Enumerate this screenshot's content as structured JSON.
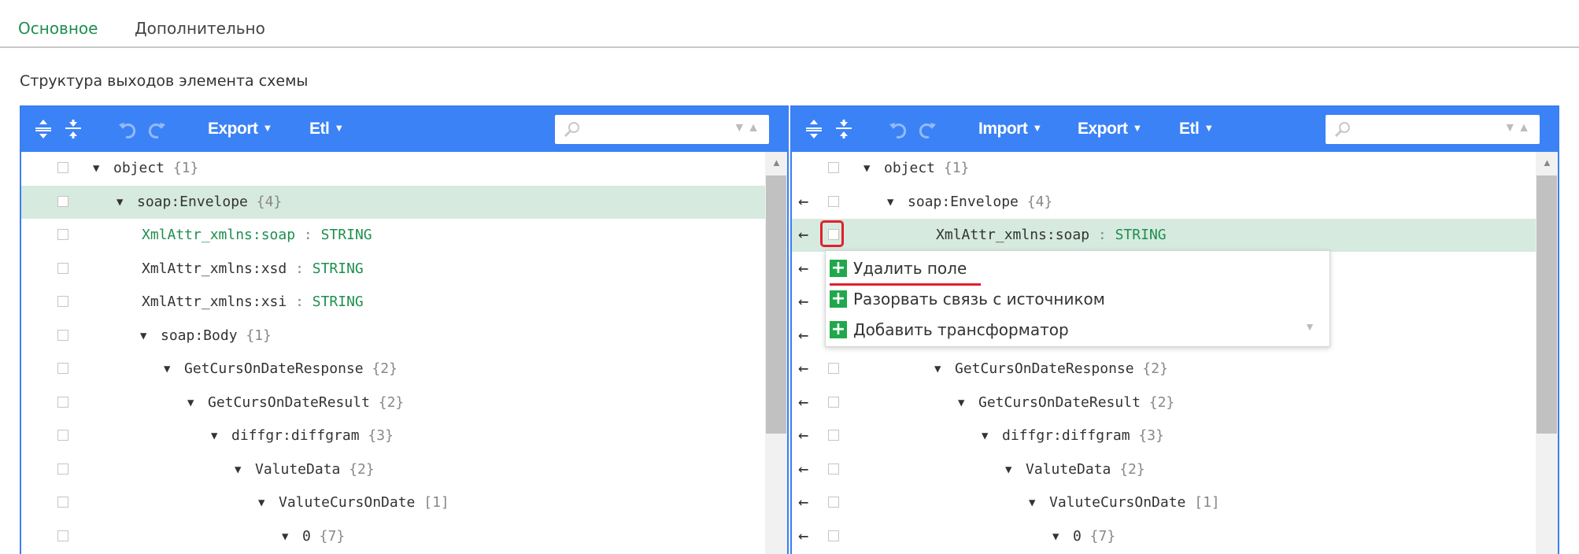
{
  "tabs": [
    {
      "label": "Основное",
      "active": true
    },
    {
      "label": "Дополнительно",
      "active": false
    }
  ],
  "section_title": "Структура выходов элемента схемы",
  "toolbar_left": {
    "icons": [
      "expand-all-icon",
      "collapse-all-icon",
      "undo-icon",
      "redo-icon"
    ],
    "export_label": "Export",
    "etl_label": "Etl",
    "search_placeholder": ""
  },
  "toolbar_right": {
    "icons": [
      "expand-all-icon",
      "collapse-all-icon",
      "undo-icon",
      "redo-icon"
    ],
    "import_label": "Import",
    "export_label": "Export",
    "etl_label": "Etl",
    "search_placeholder": ""
  },
  "left_tree": [
    {
      "name": "object",
      "count": "{1}",
      "type": "",
      "indent": 0,
      "expandable": true,
      "selected": false,
      "green": false
    },
    {
      "name": "soap:Envelope",
      "count": "{4}",
      "type": "",
      "indent": 1,
      "expandable": true,
      "selected": true,
      "green": false
    },
    {
      "name": "XmlAttr_xmlns:soap",
      "count": "",
      "type": "STRING",
      "indent": 2,
      "expandable": false,
      "selected": false,
      "green": true
    },
    {
      "name": "XmlAttr_xmlns:xsd",
      "count": "",
      "type": "STRING",
      "indent": 2,
      "expandable": false,
      "selected": false,
      "green": false
    },
    {
      "name": "XmlAttr_xmlns:xsi",
      "count": "",
      "type": "STRING",
      "indent": 2,
      "expandable": false,
      "selected": false,
      "green": false
    },
    {
      "name": "soap:Body",
      "count": "{1}",
      "type": "",
      "indent": 2,
      "expandable": true,
      "selected": false,
      "green": false
    },
    {
      "name": "GetCursOnDateResponse",
      "count": "{2}",
      "type": "",
      "indent": 3,
      "expandable": true,
      "selected": false,
      "green": false
    },
    {
      "name": "GetCursOnDateResult",
      "count": "{2}",
      "type": "",
      "indent": 4,
      "expandable": true,
      "selected": false,
      "green": false
    },
    {
      "name": "diffgr:diffgram",
      "count": "{3}",
      "type": "",
      "indent": 5,
      "expandable": true,
      "selected": false,
      "green": false
    },
    {
      "name": "ValuteData",
      "count": "{2}",
      "type": "",
      "indent": 6,
      "expandable": true,
      "selected": false,
      "green": false
    },
    {
      "name": "ValuteCursOnDate",
      "count": "[1]",
      "type": "",
      "indent": 7,
      "expandable": true,
      "selected": false,
      "green": false
    },
    {
      "name": "0",
      "count": "{7}",
      "type": "",
      "indent": 8,
      "expandable": true,
      "selected": false,
      "green": false
    }
  ],
  "right_tree": [
    {
      "name": "object",
      "count": "{1}",
      "type": "",
      "indent": 0,
      "expandable": true,
      "selected": false,
      "arrow": false
    },
    {
      "name": "soap:Envelope",
      "count": "{4}",
      "type": "",
      "indent": 1,
      "expandable": true,
      "selected": false,
      "arrow": true
    },
    {
      "name": "XmlAttr_xmlns:soap",
      "count": "",
      "type": "STRING",
      "indent": 3,
      "expandable": false,
      "selected": true,
      "arrow": true
    },
    {
      "name": "",
      "count": "",
      "type": "",
      "indent": 0,
      "expandable": false,
      "selected": false,
      "arrow": true
    },
    {
      "name": "",
      "count": "",
      "type": "",
      "indent": 0,
      "expandable": false,
      "selected": false,
      "arrow": true
    },
    {
      "name": "",
      "count": "",
      "type": "",
      "indent": 0,
      "expandable": false,
      "selected": false,
      "arrow": true
    },
    {
      "name": "GetCursOnDateResponse",
      "count": "{2}",
      "type": "",
      "indent": 3,
      "expandable": true,
      "selected": false,
      "arrow": true
    },
    {
      "name": "GetCursOnDateResult",
      "count": "{2}",
      "type": "",
      "indent": 4,
      "expandable": true,
      "selected": false,
      "arrow": true
    },
    {
      "name": "diffgr:diffgram",
      "count": "{3}",
      "type": "",
      "indent": 5,
      "expandable": true,
      "selected": false,
      "arrow": true
    },
    {
      "name": "ValuteData",
      "count": "{2}",
      "type": "",
      "indent": 6,
      "expandable": true,
      "selected": false,
      "arrow": true
    },
    {
      "name": "ValuteCursOnDate",
      "count": "[1]",
      "type": "",
      "indent": 7,
      "expandable": true,
      "selected": false,
      "arrow": true
    },
    {
      "name": "0",
      "count": "{7}",
      "type": "",
      "indent": 8,
      "expandable": true,
      "selected": false,
      "arrow": true
    }
  ],
  "context_menu": {
    "items": [
      {
        "label": "Удалить поле"
      },
      {
        "label": "Разорвать связь с источником"
      },
      {
        "label": "Добавить трансформатор"
      }
    ]
  },
  "colors": {
    "accent": "#3b82f6",
    "green": "#1e8f4e",
    "selected_row": "#d6eadf",
    "highlight_red": "#e0202c"
  }
}
